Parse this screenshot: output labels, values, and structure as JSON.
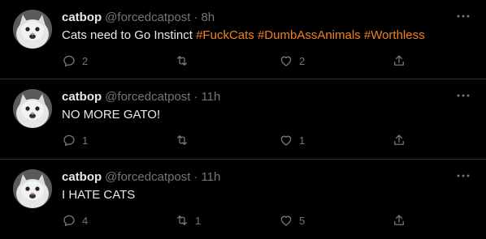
{
  "colors": {
    "background": "#000000",
    "text": "#e7e9ea",
    "muted": "#71767b",
    "hashtag": "#f4801f",
    "divider": "#2f3336"
  },
  "icons": {
    "reply": "reply-icon",
    "retweet": "retweet-icon",
    "like": "heart-icon",
    "share": "share-icon",
    "more": "more-icon"
  },
  "tweets": [
    {
      "name": "catbop",
      "handle": "@forcedcatpost",
      "time": "8h",
      "text": "Cats need to Go Instinct",
      "hashtags": [
        "#FuckCats",
        "#DumbAssAnimals",
        "#Worthless"
      ],
      "replies": "2",
      "retweets": "",
      "likes": "2"
    },
    {
      "name": "catbop",
      "handle": "@forcedcatpost",
      "time": "11h",
      "text": "NO MORE GATO!",
      "hashtags": [],
      "replies": "1",
      "retweets": "",
      "likes": "1"
    },
    {
      "name": "catbop",
      "handle": "@forcedcatpost",
      "time": "11h",
      "text": "I HATE CATS",
      "hashtags": [],
      "replies": "4",
      "retweets": "1",
      "likes": "5"
    }
  ]
}
